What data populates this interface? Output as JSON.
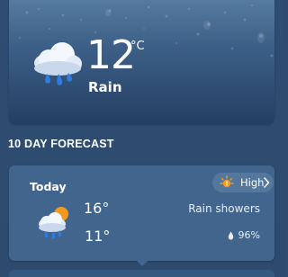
{
  "current": {
    "temperature": "12",
    "unit": "°C",
    "condition": "Rain",
    "icon": "rain-cloud-icon"
  },
  "forecast_section": {
    "title": "10 DAY FORECAST"
  },
  "forecast": [
    {
      "day": "Today",
      "high": "16°",
      "low": "11°",
      "icon": "sun-cloud-rain-icon",
      "condition": "Rain showers",
      "precipitation": "96%",
      "uv_badge": {
        "label": "High",
        "icon": "sun-alert-icon",
        "color": "#f39a1e"
      }
    }
  ],
  "colors": {
    "background": "#2e4c70",
    "card": "#42658e",
    "badge": "#54779e",
    "accent_rain": "#2f7be0",
    "sun": "#f39a1e"
  }
}
